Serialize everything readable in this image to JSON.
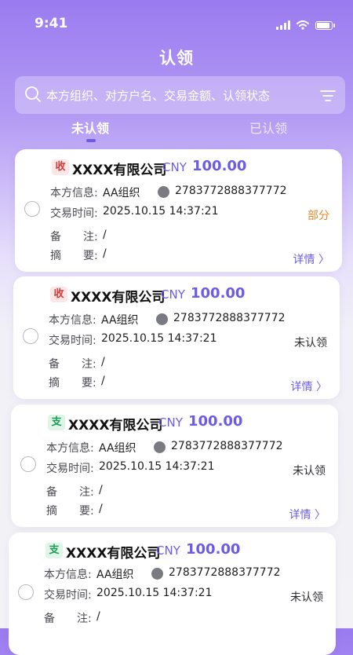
{
  "status_bar": {
    "time": "9:41"
  },
  "nav": {
    "title": "认领"
  },
  "search": {
    "placeholder": "本方组织、对方户名、交易金额、认领状态"
  },
  "tabs": [
    {
      "label": "未认领",
      "active": true
    },
    {
      "label": "已认领",
      "active": false
    }
  ],
  "labels": {
    "own_info": "本方信息:",
    "trade_time": "交易时间:",
    "remark": "备　　注:",
    "summary": "摘　　要:",
    "detail": "详情 〉"
  },
  "transactions": [
    {
      "badge": "收",
      "direction": "in",
      "company": "XXXX有限公司",
      "currency": "CNY",
      "amount": "100.00",
      "org": "AA组织",
      "account": "2783772888377772",
      "time": "2025.10.15 14:37:21",
      "remark": "/",
      "summary": "/",
      "status": "部分",
      "status_type": "partial"
    },
    {
      "badge": "收",
      "direction": "in",
      "company": "XXXX有限公司",
      "currency": "CNY",
      "amount": "100.00",
      "org": "AA组织",
      "account": "2783772888377772",
      "time": "2025.10.15 14:37:21",
      "remark": "/",
      "summary": "/",
      "status": "未认领",
      "status_type": "none"
    },
    {
      "badge": "支",
      "direction": "out",
      "company": "XXXX有限公司",
      "currency": "CNY",
      "amount": "100.00",
      "org": "AA组织",
      "account": "2783772888377772",
      "time": "2025.10.15 14:37:21",
      "remark": "/",
      "summary": "/",
      "status": "未认领",
      "status_type": "none"
    },
    {
      "badge": "支",
      "direction": "out",
      "company": "XXXX有限公司",
      "currency": "CNY",
      "amount": "100.00",
      "org": "AA组织",
      "account": "2783772888377772",
      "time": "2025.10.15 14:37:21",
      "remark": "/",
      "summary": "/",
      "status": "未认领",
      "status_type": "none"
    }
  ],
  "colors": {
    "accent": "#6b5be7",
    "partial": "#e5892d",
    "income": "#d23b3b",
    "expense": "#1e9b58"
  }
}
